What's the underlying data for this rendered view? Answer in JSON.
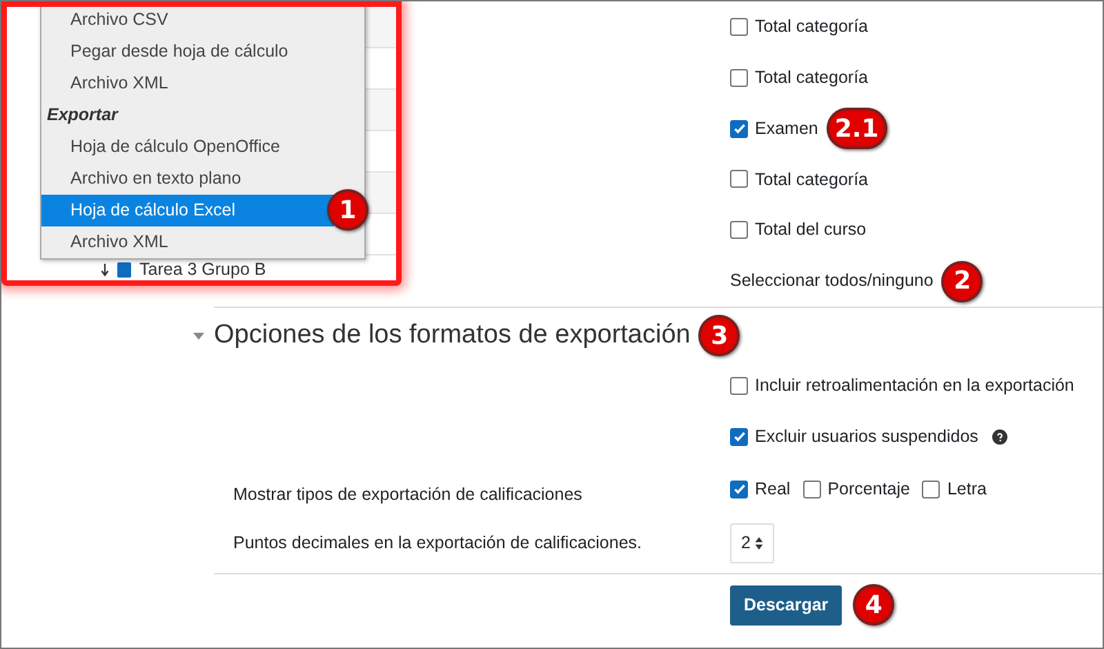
{
  "format_menu": {
    "items": [
      {
        "kind": "item",
        "label": "Archivo CSV",
        "selected": false
      },
      {
        "kind": "item",
        "label": "Pegar desde hoja de cálculo",
        "selected": false
      },
      {
        "kind": "item",
        "label": "Archivo XML",
        "selected": false
      },
      {
        "kind": "heading",
        "label": "Exportar"
      },
      {
        "kind": "item",
        "label": "Hoja de cálculo OpenOffice",
        "selected": false
      },
      {
        "kind": "item",
        "label": "Archivo en texto plano",
        "selected": false
      },
      {
        "kind": "item",
        "label": "Hoja de cálculo Excel",
        "selected": true,
        "badge": "1"
      },
      {
        "kind": "item",
        "label": "Archivo XML",
        "selected": false
      }
    ]
  },
  "background_row": {
    "label": "Tarea 3 Grupo B"
  },
  "grade_items": [
    {
      "label": "Total categoría",
      "checked": false
    },
    {
      "label": "Total categoría",
      "checked": false
    },
    {
      "label": "Examen",
      "checked": true,
      "badge": "2.1"
    },
    {
      "label": "Total categoría",
      "checked": false
    },
    {
      "label": "Total del curso",
      "checked": false
    }
  ],
  "select_all": {
    "label": "Seleccionar todos/ninguno",
    "badge": "2"
  },
  "export_options": {
    "title": "Opciones de los formatos de exportación",
    "expanded": true,
    "badge": "3",
    "include_feedback": {
      "label": "Incluir retroalimentación en la exportación",
      "checked": false
    },
    "exclude_suspended": {
      "label": "Excluir usuarios suspendidos",
      "checked": true
    },
    "display_types": {
      "label": "Mostrar tipos de exportación de calificaciones",
      "options": [
        {
          "label": "Real",
          "checked": true
        },
        {
          "label": "Porcentaje",
          "checked": false
        },
        {
          "label": "Letra",
          "checked": false
        }
      ]
    },
    "decimal_points": {
      "label": "Puntos decimales en la exportación de calificaciones.",
      "value": "2"
    }
  },
  "download_button": {
    "label": "Descargar",
    "badge": "4"
  }
}
